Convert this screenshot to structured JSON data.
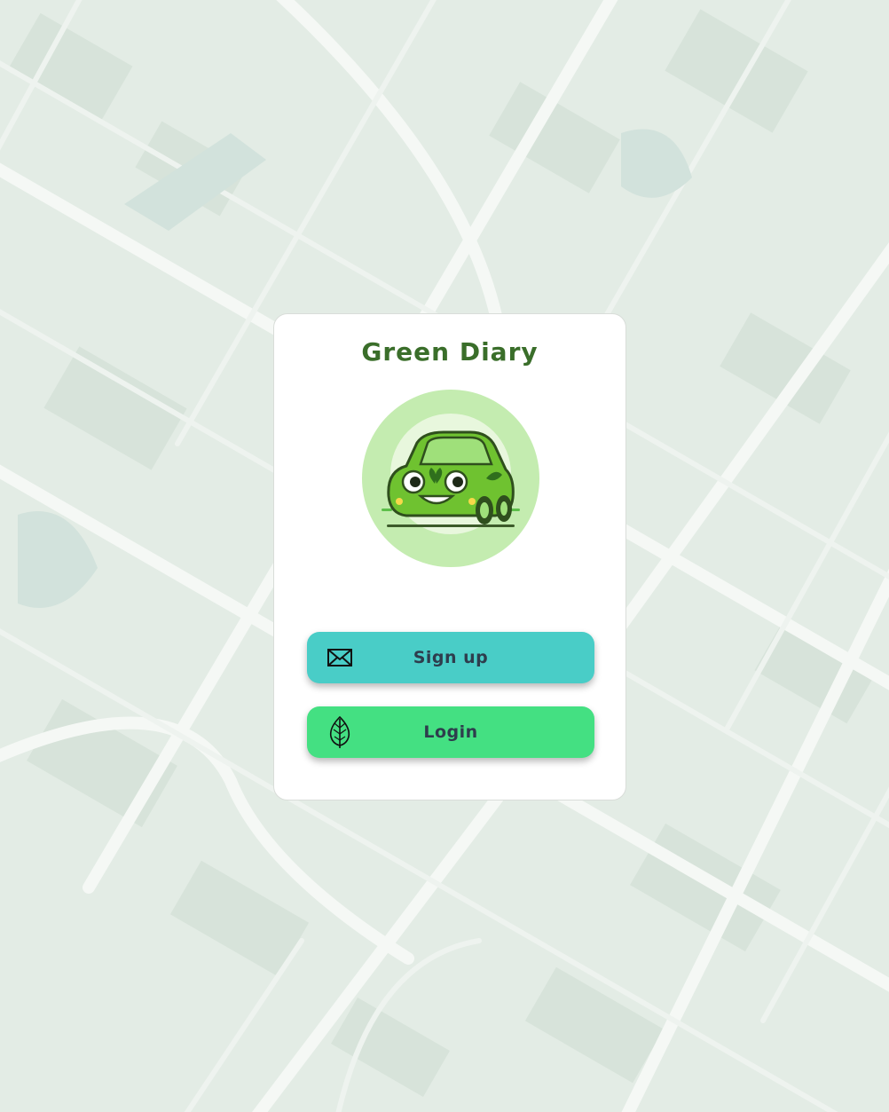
{
  "app": {
    "title": "Green Diary"
  },
  "logo": {
    "icon": "car-mascot-icon",
    "circle_color": "#c4ecb0"
  },
  "actions": {
    "signup": {
      "label": "Sign up",
      "icon": "envelope-icon",
      "color": "#49cdc7"
    },
    "login": {
      "label": "Login",
      "icon": "leaf-icon",
      "color": "#44e082"
    }
  },
  "theme": {
    "title_color": "#3a6e2a",
    "background": "#e4ede6"
  }
}
